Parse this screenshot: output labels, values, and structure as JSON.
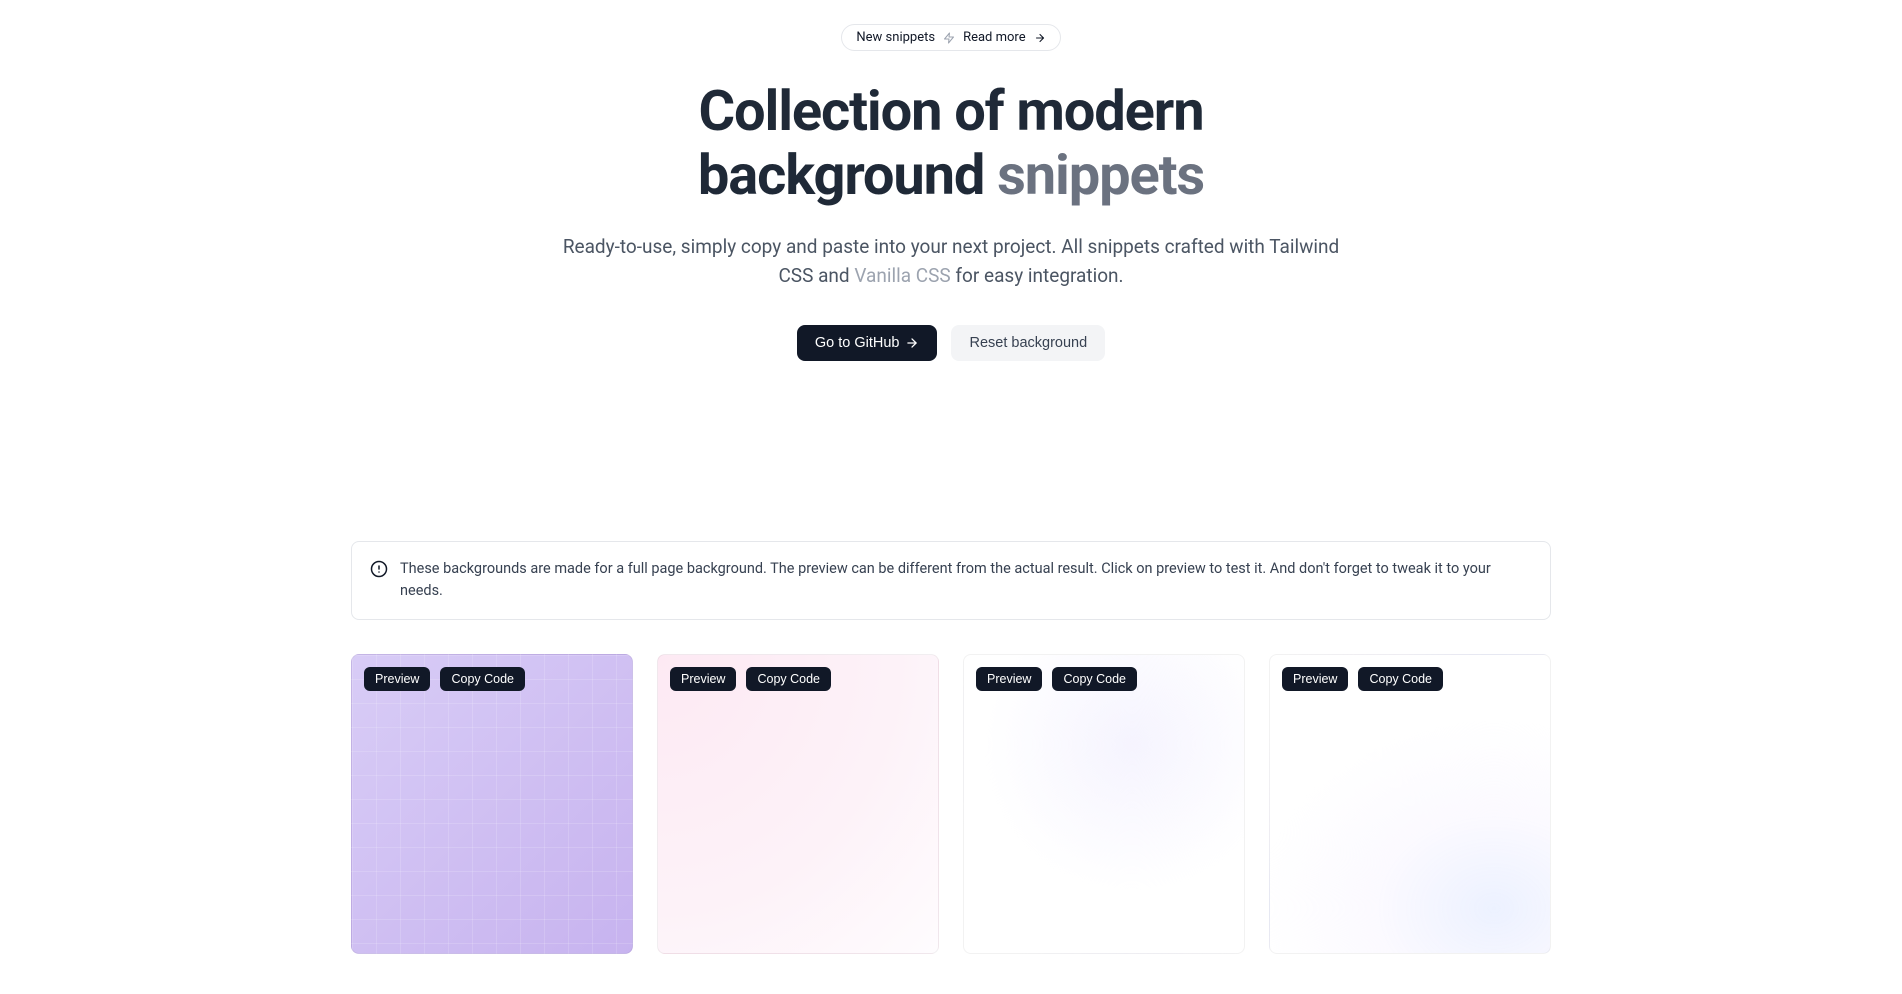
{
  "pill": {
    "left": "New snippets",
    "right": "Read more"
  },
  "hero": {
    "title_line1": "Collection of modern",
    "title_line2_a": "background",
    "title_line2_b": "snippets",
    "subtitle_a": "Ready-to-use, simply copy and paste into your next project. All snippets crafted with Tailwind CSS and ",
    "subtitle_muted": "Vanilla CSS",
    "subtitle_b": " for easy integration."
  },
  "cta": {
    "primary": "Go to GitHub",
    "secondary": "Reset background"
  },
  "notice": {
    "text": "These backgrounds are made for a full page background. The preview can be different from the actual result. Click on preview to test it. And don't forget to tweak it to your needs."
  },
  "card_buttons": {
    "preview": "Preview",
    "copy": "Copy Code"
  }
}
